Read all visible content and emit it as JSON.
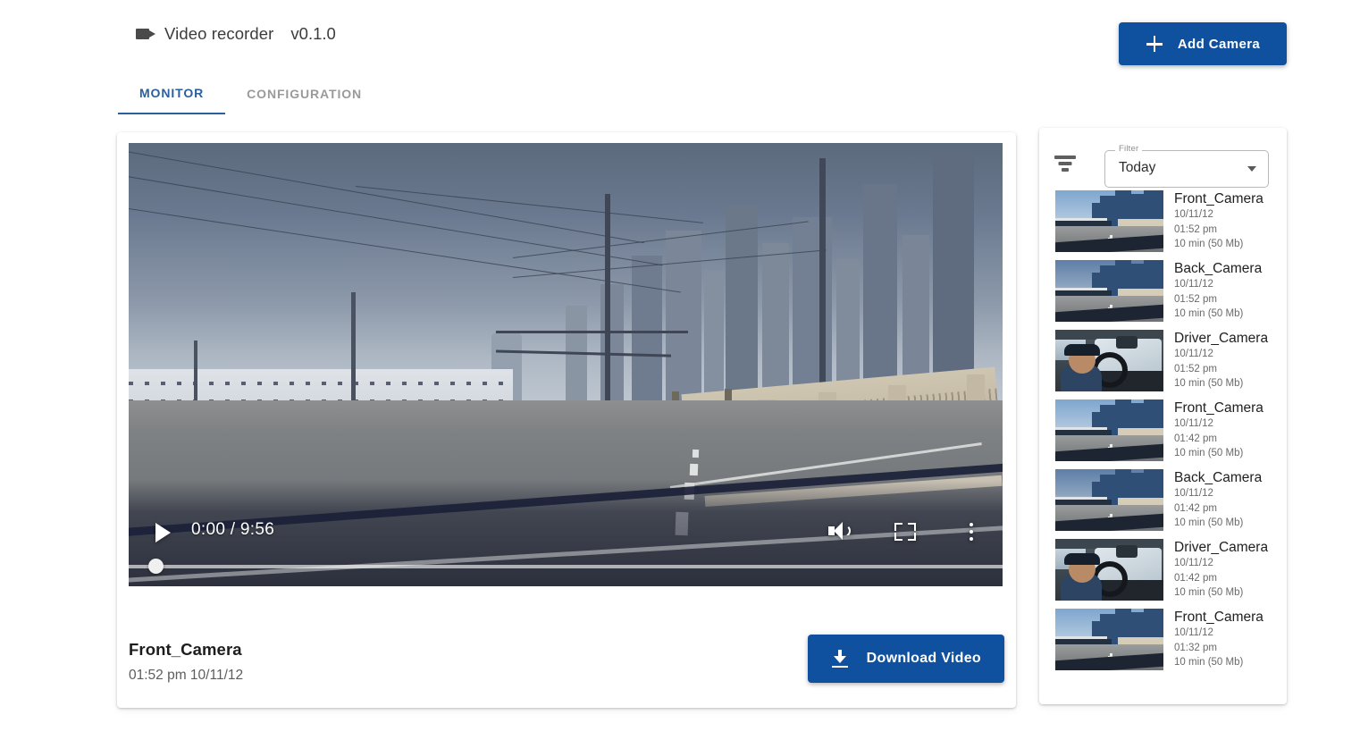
{
  "header": {
    "app_icon": "video-camera-icon",
    "title": "Video recorder",
    "version": "v0.1.0",
    "add_camera_label": "Add Camera",
    "add_icon": "plus-icon"
  },
  "tabs": [
    {
      "label": "MONITOR",
      "active": true
    },
    {
      "label": "CONFIGURATION",
      "active": false
    }
  ],
  "player": {
    "current_time": "0:00",
    "duration": "9:56",
    "time_display": "0:00 / 9:56",
    "play_icon": "play-icon",
    "volume_icon": "volume-icon",
    "fullscreen_icon": "fullscreen-icon",
    "more_icon": "more-vertical-icon",
    "progress_percent": 0,
    "scene": "dashcam front view of city road with downtown skyline"
  },
  "video_meta": {
    "name": "Front_Camera",
    "timestamp": "01:52 pm 10/11/12"
  },
  "download": {
    "label": "Download Video",
    "icon": "download-icon"
  },
  "sidebar": {
    "filter_icon": "filter-funnel-icon",
    "filter_label": "Filter",
    "filter_value": "Today",
    "caret_icon": "chevron-down-icon",
    "recordings": [
      {
        "name": "Front_Camera",
        "date": "10/11/12",
        "time": "01:52 pm",
        "size": "10 min (50 Mb)",
        "thumb": "road"
      },
      {
        "name": "Back_Camera",
        "date": "10/11/12",
        "time": "01:52 pm",
        "size": "10 min (50 Mb)",
        "thumb": "road-dim"
      },
      {
        "name": "Driver_Camera",
        "date": "10/11/12",
        "time": "01:52 pm",
        "size": "10 min (50 Mb)",
        "thumb": "driver"
      },
      {
        "name": "Front_Camera",
        "date": "10/11/12",
        "time": "01:42 pm",
        "size": "10 min (50 Mb)",
        "thumb": "road"
      },
      {
        "name": "Back_Camera",
        "date": "10/11/12",
        "time": "01:42 pm",
        "size": "10 min (50 Mb)",
        "thumb": "road-dim"
      },
      {
        "name": "Driver_Camera",
        "date": "10/11/12",
        "time": "01:42 pm",
        "size": "10 min (50 Mb)",
        "thumb": "driver"
      },
      {
        "name": "Front_Camera",
        "date": "10/11/12",
        "time": "01:32 pm",
        "size": "10 min (50 Mb)",
        "thumb": "road"
      }
    ]
  },
  "colors": {
    "primary_blue": "#10519f",
    "tab_active": "#2b5f9e",
    "tab_inactive": "#9a9a9a",
    "text_primary": "#1d1d1d",
    "text_muted": "#6a6a6a",
    "page_background": "#ffffff"
  }
}
